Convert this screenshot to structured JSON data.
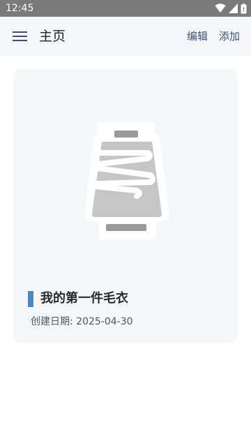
{
  "status_bar": {
    "time": "12:45",
    "icons": [
      "wifi-icon",
      "signal-icon",
      "battery-icon"
    ]
  },
  "app_bar": {
    "menu_icon": "hamburger-menu-icon",
    "title": "主页",
    "edit_label": "编辑",
    "add_label": "添加"
  },
  "projects": [
    {
      "image_icon": "yarn-spool-icon",
      "title": "我的第一件毛衣",
      "created": "创建日期: 2025-04-30"
    }
  ],
  "colors": {
    "accent": "#4a8ac0",
    "action_text": "#3d4f7a",
    "status_bar": "#7a7a7a",
    "card_background": "#f6f7f9"
  }
}
